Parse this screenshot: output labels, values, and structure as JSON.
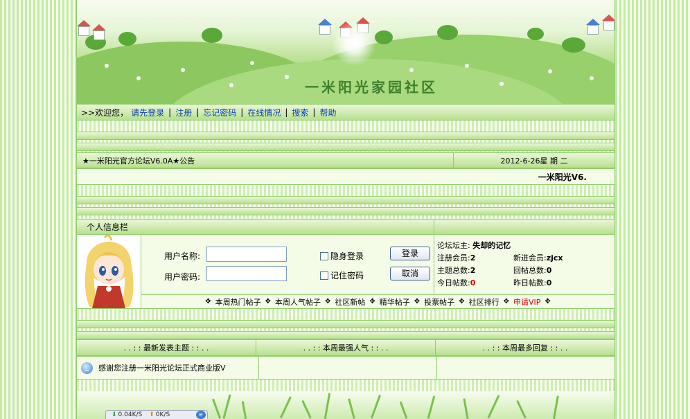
{
  "banner": {
    "title": "一米阳光家园社区"
  },
  "nav": {
    "welcome": ">>欢迎您，",
    "links": [
      "请先登录",
      "注册",
      "忘记密码",
      "在线情况",
      "搜索",
      "帮助"
    ],
    "separator": "|"
  },
  "notice": {
    "title": "★一米阳光官方论坛V6.0A★公告",
    "date": "2012-6-26星 期 二",
    "ticker": "一米阳光V6."
  },
  "personal": {
    "header": "个人信息栏",
    "username_label": "用户名称:",
    "password_label": "用户密码:",
    "username_value": "",
    "password_value": "",
    "hidden_login": "隐身登录",
    "remember_pw": "记住密码",
    "login_btn": "登录",
    "cancel_btn": "取消"
  },
  "stats": {
    "owner_label": "论坛坛主:",
    "owner_value": "失却的记忆",
    "members_label": "注册会员:",
    "members_value": "2",
    "new_member_label": "新进会员:",
    "new_member_value": "zjcx",
    "topics_label": "主题总数:",
    "topics_value": "2",
    "replies_label": "回帖总数:",
    "replies_value": "0",
    "today_label": "今日帖数:",
    "today_value": "0",
    "yesterday_label": "昨日帖数:",
    "yesterday_value": "0"
  },
  "quick_links": [
    "本周热门帖子",
    "本周人气帖子",
    "社区新帖",
    "精华帖子",
    "投票帖子",
    "社区排行",
    "申请VIP"
  ],
  "columns": {
    "headers": [
      ". . : : 最新发表主题 : : . .",
      ". . : : 本周最强人气 : : . .",
      ". . : : 本周最多回复 : : . ."
    ],
    "latest_topic": "感谢您注册一米阳光论坛正式商业版V"
  },
  "netmeter": {
    "down": "0.04K/S",
    "up": "0K/S"
  },
  "colors": {
    "accent_green": "#8fcf6a",
    "link_blue": "#0a3fb0",
    "vip_red": "#dd0000"
  }
}
